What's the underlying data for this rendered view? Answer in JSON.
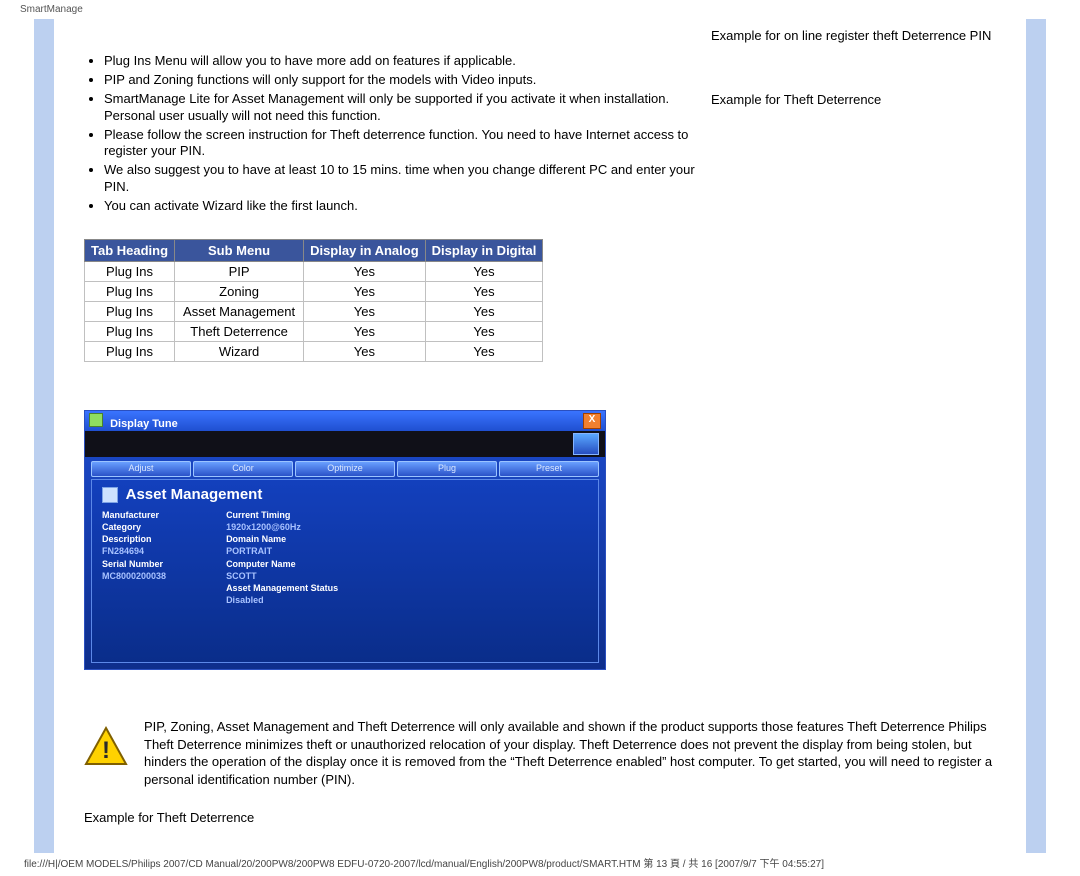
{
  "header_small": "SmartManage",
  "bullets": [
    "Plug Ins Menu will allow you to have more add on features if applicable.",
    "PIP and Zoning functions will only support for the models with Video inputs.",
    "SmartManage Lite for Asset Management will only be supported if you activate it when installation. Personal user usually will not need this function.",
    "Please follow the screen instruction for Theft deterrence function. You need to have Internet access to register your PIN.",
    "We also suggest you to have at least 10 to 15 mins. time when you change different PC and enter your PIN.",
    "You can activate Wizard like the first launch."
  ],
  "table": {
    "headers": [
      "Tab Heading",
      "Sub Menu",
      "Display in Analog",
      "Display in Digital"
    ],
    "rows": [
      [
        "Plug Ins",
        "PIP",
        "Yes",
        "Yes"
      ],
      [
        "Plug Ins",
        "Zoning",
        "Yes",
        "Yes"
      ],
      [
        "Plug Ins",
        "Asset Management",
        "Yes",
        "Yes"
      ],
      [
        "Plug Ins",
        "Theft Deterrence",
        "Yes",
        "Yes"
      ],
      [
        "Plug Ins",
        "Wizard",
        "Yes",
        "Yes"
      ]
    ]
  },
  "side": {
    "item1": "Example for on line register theft Deterrence PIN",
    "item2": "Example for Theft Deterrence"
  },
  "app": {
    "title": "Display Tune",
    "close": "X",
    "tabs": [
      "Adjust",
      "Color",
      "Optimize",
      "Plug",
      "Preset"
    ],
    "panel_title": "Asset Management",
    "left_labels": [
      "Manufacturer",
      "Category",
      "Description",
      "FN284694",
      "Serial Number",
      "MC8000200038"
    ],
    "right_labels": [
      "Current Timing",
      "1920x1200@60Hz",
      "Domain Name",
      "PORTRAIT",
      "Computer Name",
      "SCOTT",
      "Asset Management Status",
      "Disabled"
    ]
  },
  "warning_text": "PIP, Zoning, Asset Management and Theft Deterrence will only available and shown if the product supports those features Theft Deterrence Philips Theft Deterrence minimizes theft or unauthorized relocation of your display. Theft Deterrence does not prevent the display from being stolen, but hinders the operation of the display once it is removed from the “Theft Deterrence enabled” host computer. To get started, you will need to register a personal identification number (PIN).",
  "example_label": "Example for Theft Deterrence",
  "footer": "file:///H|/OEM MODELS/Philips 2007/CD Manual/20/200PW8/200PW8 EDFU-0720-2007/lcd/manual/English/200PW8/product/SMART.HTM 第 13 頁 / 共 16  [2007/9/7 下午 04:55:27]"
}
